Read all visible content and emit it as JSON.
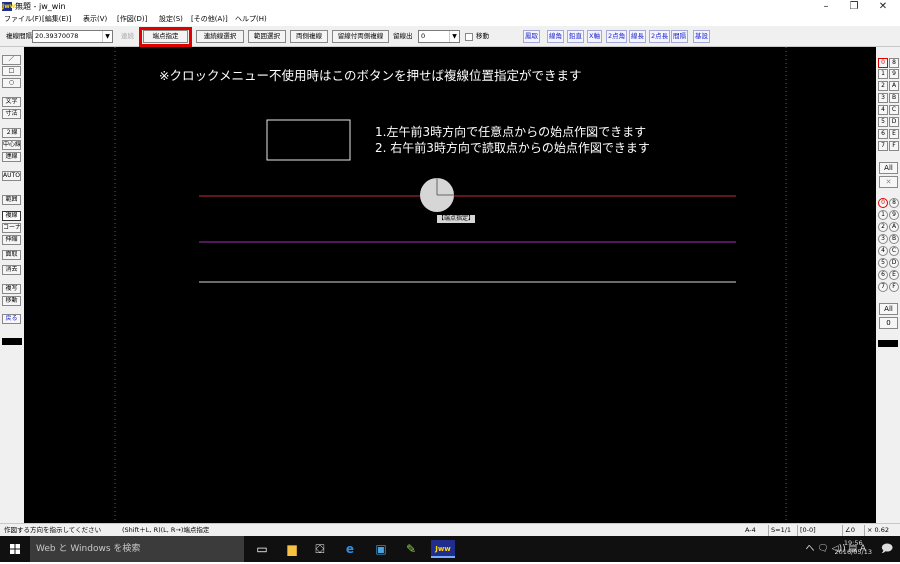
{
  "window": {
    "title": "無題 - jw_win",
    "app_icon": "Jww",
    "minimize": "–",
    "restore": "❐",
    "close": "✕"
  },
  "menu": [
    "ファイル(F)",
    "[編集(E)]",
    "表示(V)",
    "[作図(D)]",
    "設定(S)",
    "[その他(A)]",
    "ヘルプ(H)"
  ],
  "toolbar": {
    "spacing_label": "複線間隔",
    "spacing_value": "20.39370078",
    "renzoku": "連続",
    "endpoint": "端点指定",
    "continuous_select": "連続線選択",
    "range_select": "範囲選択",
    "both_sides": "両側複線",
    "tome_both": "留線付両側複線",
    "tome_out_label": "留線出",
    "tome_out_value": "0",
    "move": "移動",
    "links": [
      "鳳取",
      "線角",
      "鉛直",
      "X軸",
      "2点角",
      "線長",
      "2点長",
      "間隔",
      "基設"
    ]
  },
  "left_tools": [
    "／",
    "□",
    "○",
    "文字",
    "寸法",
    "２線",
    "中心線",
    "連線",
    "AUTO",
    "範囲",
    "複線",
    "コーナー",
    "伸縮",
    "面取",
    "消去",
    "複写",
    "移動",
    "戻る"
  ],
  "right_tools": {
    "row_a": [
      [
        "0",
        "8"
      ],
      [
        "1",
        "9"
      ],
      [
        "2",
        "A"
      ],
      [
        "3",
        "B"
      ],
      [
        "4",
        "C"
      ],
      [
        "5",
        "D"
      ],
      [
        "6",
        "E"
      ],
      [
        "7",
        "F"
      ]
    ],
    "all1": "All",
    "x": "✕",
    "row_b": [
      [
        "0",
        "8"
      ],
      [
        "1",
        "9"
      ],
      [
        "2",
        "A"
      ],
      [
        "3",
        "B"
      ],
      [
        "4",
        "C"
      ],
      [
        "5",
        "D"
      ],
      [
        "6",
        "E"
      ],
      [
        "7",
        "F"
      ]
    ],
    "all2": "All",
    "zero": "0"
  },
  "canvas": {
    "notice": "※クロックメニュー不使用時はこのボタンを押せば複線位置指定ができます",
    "instruction1": "1.左午前3時方向で任意点からの始点作図できます",
    "instruction2": "2. 右午前3時方向で読取点からの始点作図できます",
    "clock_label": "【端点指定】"
  },
  "status": {
    "hint": "作図する方向を指示してください",
    "shortcut": "(Shift＋L, R)(L, R→)端点指定",
    "paper": "A-4",
    "scale": "S=1/1",
    "layer": "[0-0]",
    "angle": "∠0",
    "zoom": "× 0.62"
  },
  "taskbar": {
    "search": "Web と Windows を検索",
    "tray": "へ 🗨 ◁)) ▤ A",
    "time": "19:56",
    "date": "2016/05/13"
  }
}
